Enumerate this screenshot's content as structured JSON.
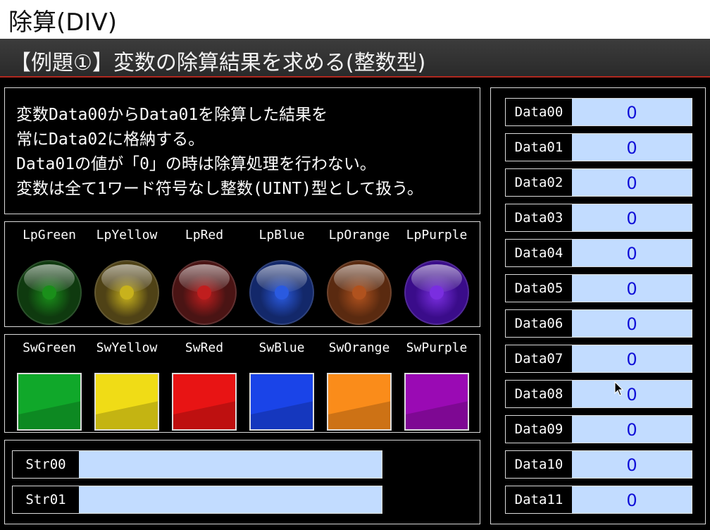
{
  "title": "除算(DIV)",
  "subtitle": "【例題①】変数の除算結果を求める(整数型)",
  "description": [
    "変数Data00からData01を除算した結果を",
    "常にData02に格納する。",
    "Data01の値が「0」の時は除算処理を行わない。",
    "変数は全て1ワード符号なし整数(UINT)型として扱う。"
  ],
  "lamps": [
    {
      "label": "LpGreen",
      "color": "#0f3a0f",
      "core": "#1a8f1a"
    },
    {
      "label": "LpYellow",
      "color": "#4f4216",
      "core": "#c8b21c"
    },
    {
      "label": "LpRed",
      "color": "#4a1414",
      "core": "#c01e1e"
    },
    {
      "label": "LpBlue",
      "color": "#13286a",
      "core": "#2a5ae0"
    },
    {
      "label": "LpOrange",
      "color": "#5a2a10",
      "core": "#b0521e"
    },
    {
      "label": "LpPurple",
      "color": "#3a0c8a",
      "core": "#7a2ee0"
    }
  ],
  "switches": [
    {
      "label": "SwGreen",
      "color": "#10a82a"
    },
    {
      "label": "SwYellow",
      "color": "#f0dc16"
    },
    {
      "label": "SwRed",
      "color": "#e81414"
    },
    {
      "label": "SwBlue",
      "color": "#1a44e8"
    },
    {
      "label": "SwOrange",
      "color": "#fa8c1a"
    },
    {
      "label": "SwPurple",
      "color": "#9a0ab4"
    }
  ],
  "strings": [
    {
      "label": "Str00",
      "value": ""
    },
    {
      "label": "Str01",
      "value": ""
    }
  ],
  "data": [
    {
      "label": "Data00",
      "value": "0"
    },
    {
      "label": "Data01",
      "value": "0"
    },
    {
      "label": "Data02",
      "value": "0"
    },
    {
      "label": "Data03",
      "value": "0"
    },
    {
      "label": "Data04",
      "value": "0"
    },
    {
      "label": "Data05",
      "value": "0"
    },
    {
      "label": "Data06",
      "value": "0"
    },
    {
      "label": "Data07",
      "value": "0"
    },
    {
      "label": "Data08",
      "value": "0"
    },
    {
      "label": "Data09",
      "value": "0"
    },
    {
      "label": "Data10",
      "value": "0"
    },
    {
      "label": "Data11",
      "value": "0"
    }
  ]
}
